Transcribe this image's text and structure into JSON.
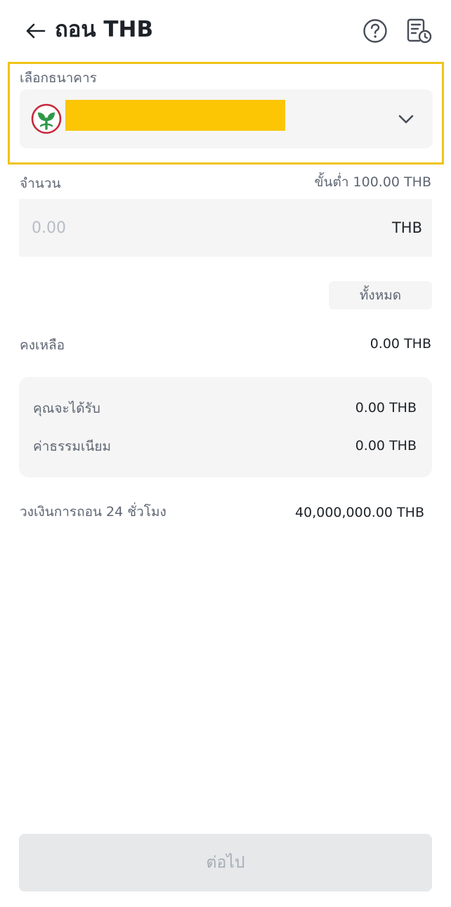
{
  "header": {
    "title": "ถอน THB",
    "back_icon": "arrow-left-icon",
    "help_icon": "question-circle-icon",
    "history_icon": "order-history-icon"
  },
  "bank": {
    "label": "เลือกธนาคาร",
    "logo_icon": "kasikorn-bank-logo-icon",
    "chevron_icon": "chevron-down-icon",
    "highlight_color": "#f0c419",
    "redaction_color": "#fcc605"
  },
  "amount": {
    "label": "จำนวน",
    "minimum": "ขั้นต่ำ 100.00 THB",
    "placeholder": "0.00",
    "currency": "THB",
    "all_button": "ทั้งหมด"
  },
  "balance": {
    "label": "คงเหลือ",
    "value": "0.00 THB"
  },
  "summary": {
    "receive_label": "คุณจะได้รับ",
    "receive_value": "0.00 THB",
    "fee_label": "ค่าธรรมเนียม",
    "fee_value": "0.00 THB"
  },
  "limit": {
    "label": "วงเงินการถอน 24 ชั่วโมง",
    "value": "40,000,000.00 THB"
  },
  "footer": {
    "next_button": "ต่อไป"
  }
}
